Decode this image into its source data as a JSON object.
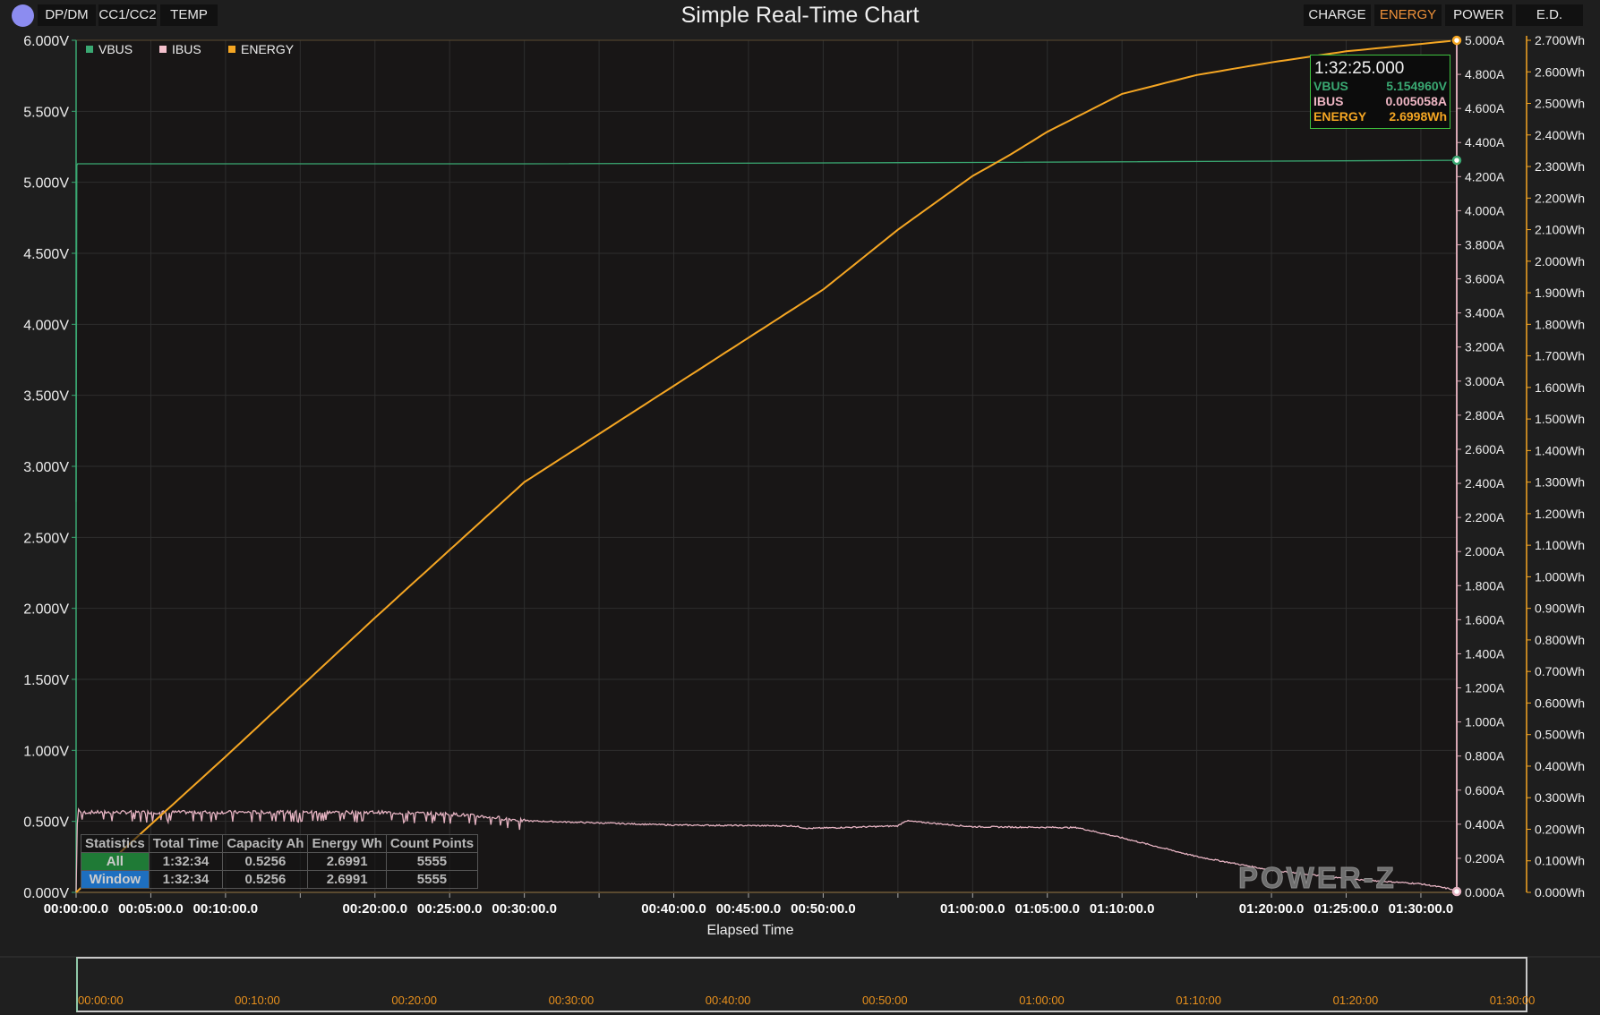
{
  "header": {
    "title": "Simple Real-Time Chart",
    "left_buttons": [
      "DP/DM",
      "CC1/CC2",
      "TEMP"
    ],
    "right_buttons": [
      "CHARGE",
      "ENERGY",
      "POWER",
      "E.D."
    ],
    "active_button": "ENERGY"
  },
  "tooltip": {
    "time": "1:32:25.000",
    "rows": [
      {
        "label": "VBUS",
        "value": "5.154960V"
      },
      {
        "label": "IBUS",
        "value": "0.005058A"
      },
      {
        "label": "ENERGY",
        "value": "2.6998Wh"
      }
    ]
  },
  "statistics": {
    "headers": [
      "Statistics",
      "Total Time",
      "Capacity Ah",
      "Energy Wh",
      "Count Points"
    ],
    "rows": [
      [
        "All",
        "1:32:34",
        "0.5256",
        "2.6991",
        "5555"
      ],
      [
        "Window",
        "1:32:34",
        "0.5256",
        "2.6991",
        "5555"
      ]
    ]
  },
  "watermark": "POWER-Z",
  "navigator": {
    "labels": [
      "00:00:00",
      "00:10:00",
      "00:20:00",
      "00:30:00",
      "00:40:00",
      "00:50:00",
      "01:00:00",
      "01:10:00",
      "01:20:00",
      "01:30:00"
    ]
  },
  "colors": {
    "vbus": "#3aa872",
    "ibus": "#e6b3c2",
    "energy": "#f5a623",
    "background": "#1e1e1e",
    "plot": "#181616"
  },
  "chart_data": {
    "type": "line",
    "title": "Simple Real-Time Chart",
    "xlabel": "Elapsed Time",
    "xunit": "minutes",
    "xlim": [
      0,
      92.4
    ],
    "x_tick_labels": [
      "00:00:00.0",
      "00:05:00.0",
      "00:10:00.0",
      "00:20:00.0",
      "00:25:00.0",
      "00:30:00.0",
      "00:40:00.0",
      "00:45:00.0",
      "00:50:00.0",
      "01:00:00.0",
      "01:05:00.0",
      "01:10:00.0",
      "01:20:00.0",
      "01:25:00.0",
      "01:30:00.0"
    ],
    "x_tick_values": [
      0,
      5,
      10,
      20,
      25,
      30,
      40,
      45,
      50,
      60,
      65,
      70,
      80,
      85,
      90
    ],
    "y_axes": [
      {
        "name": "voltage",
        "ylim": [
          0,
          6
        ],
        "tick_labels": [
          "0.000V",
          "0.500V",
          "1.000V",
          "1.500V",
          "2.000V",
          "2.500V",
          "3.000V",
          "3.500V",
          "4.000V",
          "4.500V",
          "5.000V",
          "5.500V",
          "6.000V"
        ]
      },
      {
        "name": "current",
        "ylim": [
          0,
          5
        ],
        "tick_labels": [
          "0.000A",
          "0.200A",
          "0.400A",
          "0.600A",
          "0.800A",
          "1.000A",
          "1.200A",
          "1.400A",
          "1.600A",
          "1.800A",
          "2.000A",
          "2.200A",
          "2.400A",
          "2.600A",
          "2.800A",
          "3.000A",
          "3.200A",
          "3.400A",
          "3.600A",
          "3.800A",
          "4.000A",
          "4.200A",
          "4.400A",
          "4.600A",
          "4.800A",
          "5.000A"
        ]
      },
      {
        "name": "energy",
        "ylim": [
          0,
          2.7
        ],
        "tick_labels": [
          "0.000Wh",
          "0.100Wh",
          "0.200Wh",
          "0.300Wh",
          "0.400Wh",
          "0.500Wh",
          "0.600Wh",
          "0.700Wh",
          "0.800Wh",
          "0.900Wh",
          "1.000Wh",
          "1.100Wh",
          "1.200Wh",
          "1.300Wh",
          "1.400Wh",
          "1.500Wh",
          "1.600Wh",
          "1.700Wh",
          "1.800Wh",
          "1.900Wh",
          "2.000Wh",
          "2.100Wh",
          "2.200Wh",
          "2.300Wh",
          "2.400Wh",
          "2.500Wh",
          "2.600Wh",
          "2.700Wh"
        ]
      }
    ],
    "legend": {
      "position": "top-left",
      "entries": [
        "VBUS",
        "IBUS",
        "ENERGY"
      ]
    },
    "grid": true,
    "series": [
      {
        "name": "VBUS",
        "axis": "voltage",
        "x": [
          0,
          0.05,
          0.1,
          30,
          60,
          92.4
        ],
        "y": [
          2.75,
          5.12,
          5.13,
          5.13,
          5.14,
          5.155
        ]
      },
      {
        "name": "IBUS",
        "axis": "current",
        "x": [
          0,
          0.1,
          0.3,
          10,
          20,
          25,
          28,
          30,
          40,
          48,
          49,
          55,
          55.5,
          60,
          67,
          70,
          75,
          80,
          85,
          90,
          92,
          92.4
        ],
        "y": [
          0,
          0.5,
          0.47,
          0.47,
          0.47,
          0.46,
          0.44,
          0.42,
          0.395,
          0.39,
          0.375,
          0.39,
          0.42,
          0.385,
          0.38,
          0.32,
          0.21,
          0.13,
          0.08,
          0.05,
          0.02,
          0.005
        ]
      },
      {
        "name": "ENERGY",
        "axis": "energy",
        "x": [
          0,
          10,
          20,
          30,
          40,
          50,
          55,
          60,
          62.4,
          65,
          70,
          75,
          80,
          85,
          92.4
        ],
        "y": [
          0,
          0.43,
          0.87,
          1.3,
          1.605,
          1.91,
          2.1,
          2.27,
          2.334,
          2.41,
          2.53,
          2.59,
          2.63,
          2.665,
          2.6998
        ]
      }
    ]
  }
}
